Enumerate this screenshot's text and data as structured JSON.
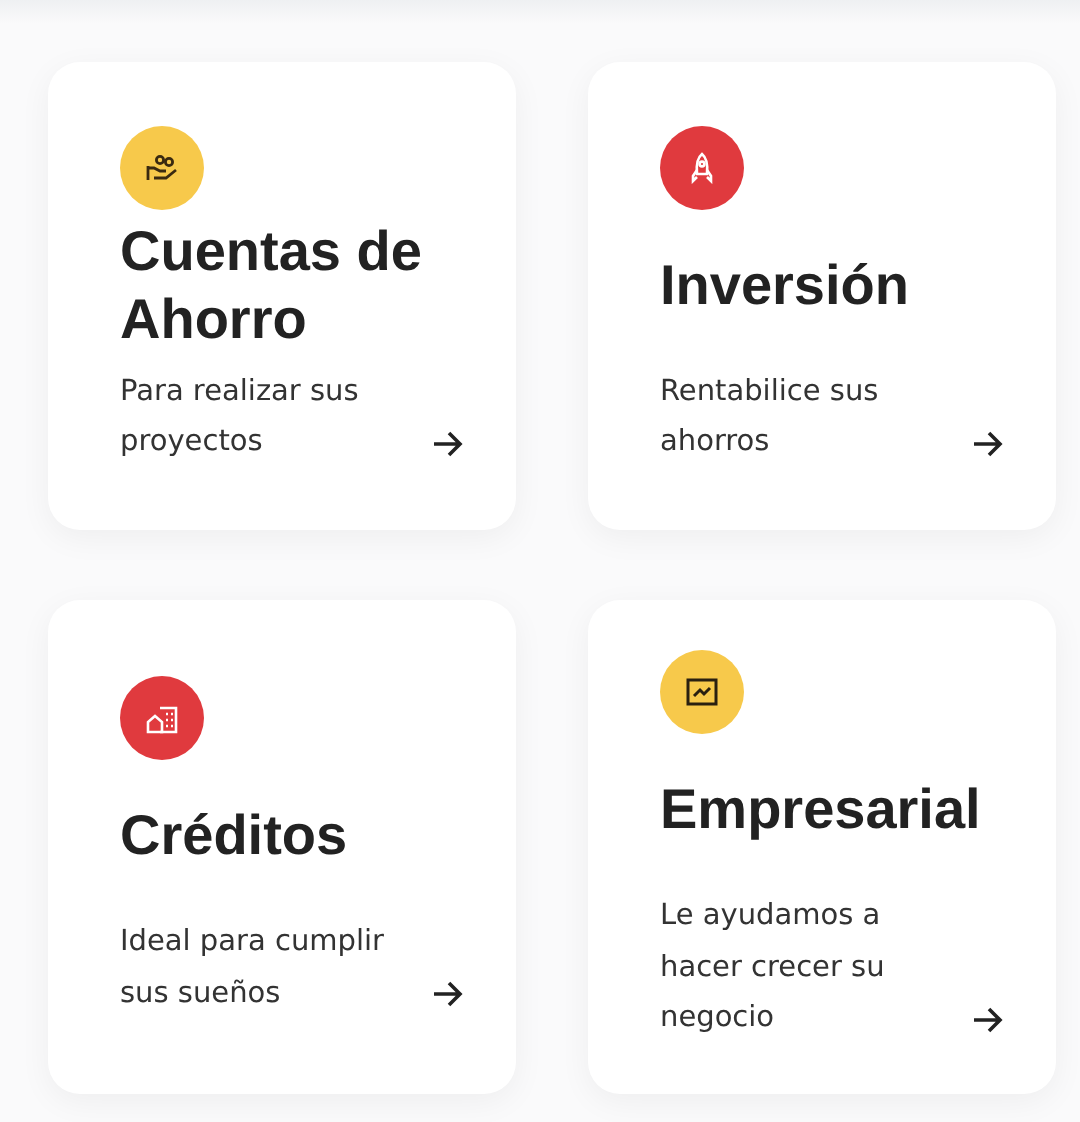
{
  "cards": [
    {
      "title": "Cuentas de Ahorro",
      "description": "Para realizar sus proyectos",
      "color": "#f7c94b"
    },
    {
      "title": "Inversión",
      "description": "Rentabilice sus ahorros",
      "color": "#e03a3e"
    },
    {
      "title": "Créditos",
      "description": "Ideal para cumplir sus sueños",
      "color": "#e03a3e"
    },
    {
      "title": "Empresarial",
      "description": "Le ayudamos a hacer crecer su negocio",
      "color": "#f7c94b"
    }
  ]
}
